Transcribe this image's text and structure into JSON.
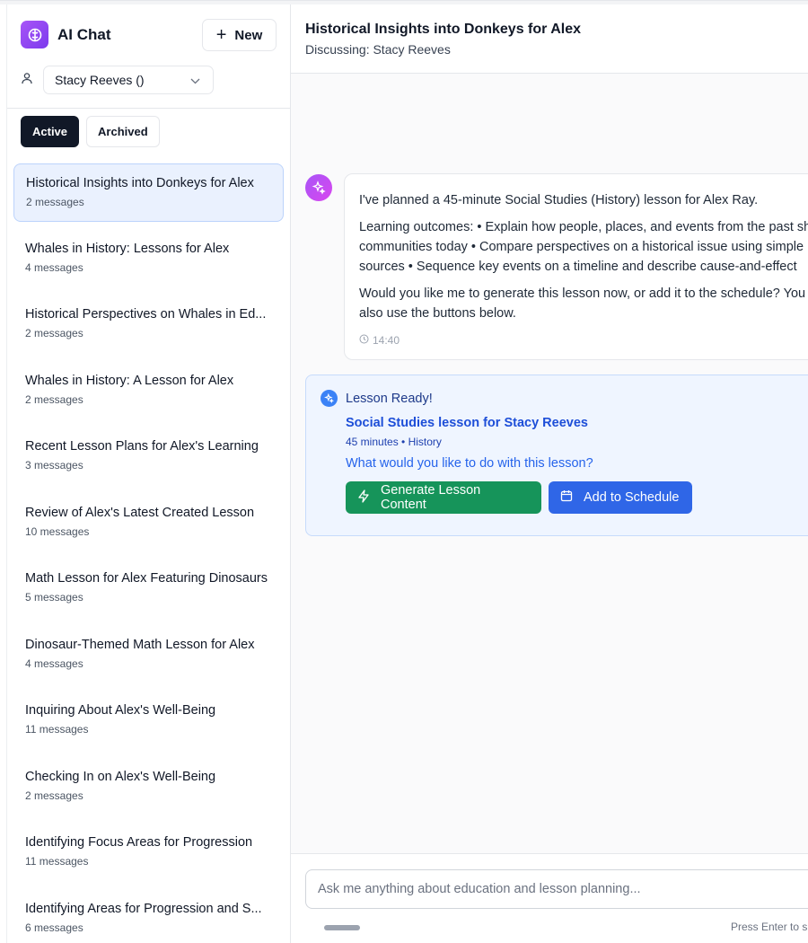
{
  "app": {
    "title": "AI Chat",
    "new_label": "New"
  },
  "user_select": {
    "value": "Stacy Reeves ()"
  },
  "tabs": [
    {
      "label": "Active"
    },
    {
      "label": "Archived"
    }
  ],
  "conversations": [
    {
      "title": "Historical Insights into Donkeys for Alex",
      "count": "2 messages"
    },
    {
      "title": "Whales in History: Lessons for Alex",
      "count": "4 messages"
    },
    {
      "title": "Historical Perspectives on Whales in Ed...",
      "count": "2 messages"
    },
    {
      "title": "Whales in History: A Lesson for Alex",
      "count": "2 messages"
    },
    {
      "title": "Recent Lesson Plans for Alex's Learning",
      "count": "3 messages"
    },
    {
      "title": "Review of Alex's Latest Created Lesson",
      "count": "10 messages"
    },
    {
      "title": "Math Lesson for Alex Featuring Dinosaurs",
      "count": "5 messages"
    },
    {
      "title": "Dinosaur-Themed Math Lesson for Alex",
      "count": "4 messages"
    },
    {
      "title": "Inquiring About Alex's Well-Being",
      "count": "11 messages"
    },
    {
      "title": "Checking In on Alex's Well-Being",
      "count": "2 messages"
    },
    {
      "title": "Identifying Focus Areas for Progression",
      "count": "11 messages"
    },
    {
      "title": "Identifying Areas for Progression and S...",
      "count": "6 messages"
    }
  ],
  "chat": {
    "title": "Historical Insights into Donkeys for Alex",
    "subtitle": "Discussing: Stacy Reeves",
    "message": {
      "p1": "I've planned a 45-minute Social Studies (History) lesson for Alex Ray.",
      "p2a": "Learning outcomes: • Explain how people, places, and events from the past sh",
      "p2b": "communities today • Compare perspectives on a historical issue using simple",
      "p2c": "sources • Sequence key events on a timeline and describe cause-and-effect",
      "p3a": "Would you like me to generate this lesson now, or add it to the schedule? You c",
      "p3b": "also use the buttons below.",
      "time": "14:40"
    },
    "lesson": {
      "heading": "Lesson Ready!",
      "title": "Social Studies lesson for Stacy Reeves",
      "meta": "45 minutes • History",
      "question": "What would you like to do with this lesson?",
      "generate_label": "Generate Lesson Content",
      "schedule_label": "Add to Schedule"
    },
    "composer": {
      "placeholder": "Ask me anything about education and lesson planning...",
      "hint": "Press Enter to s"
    }
  }
}
